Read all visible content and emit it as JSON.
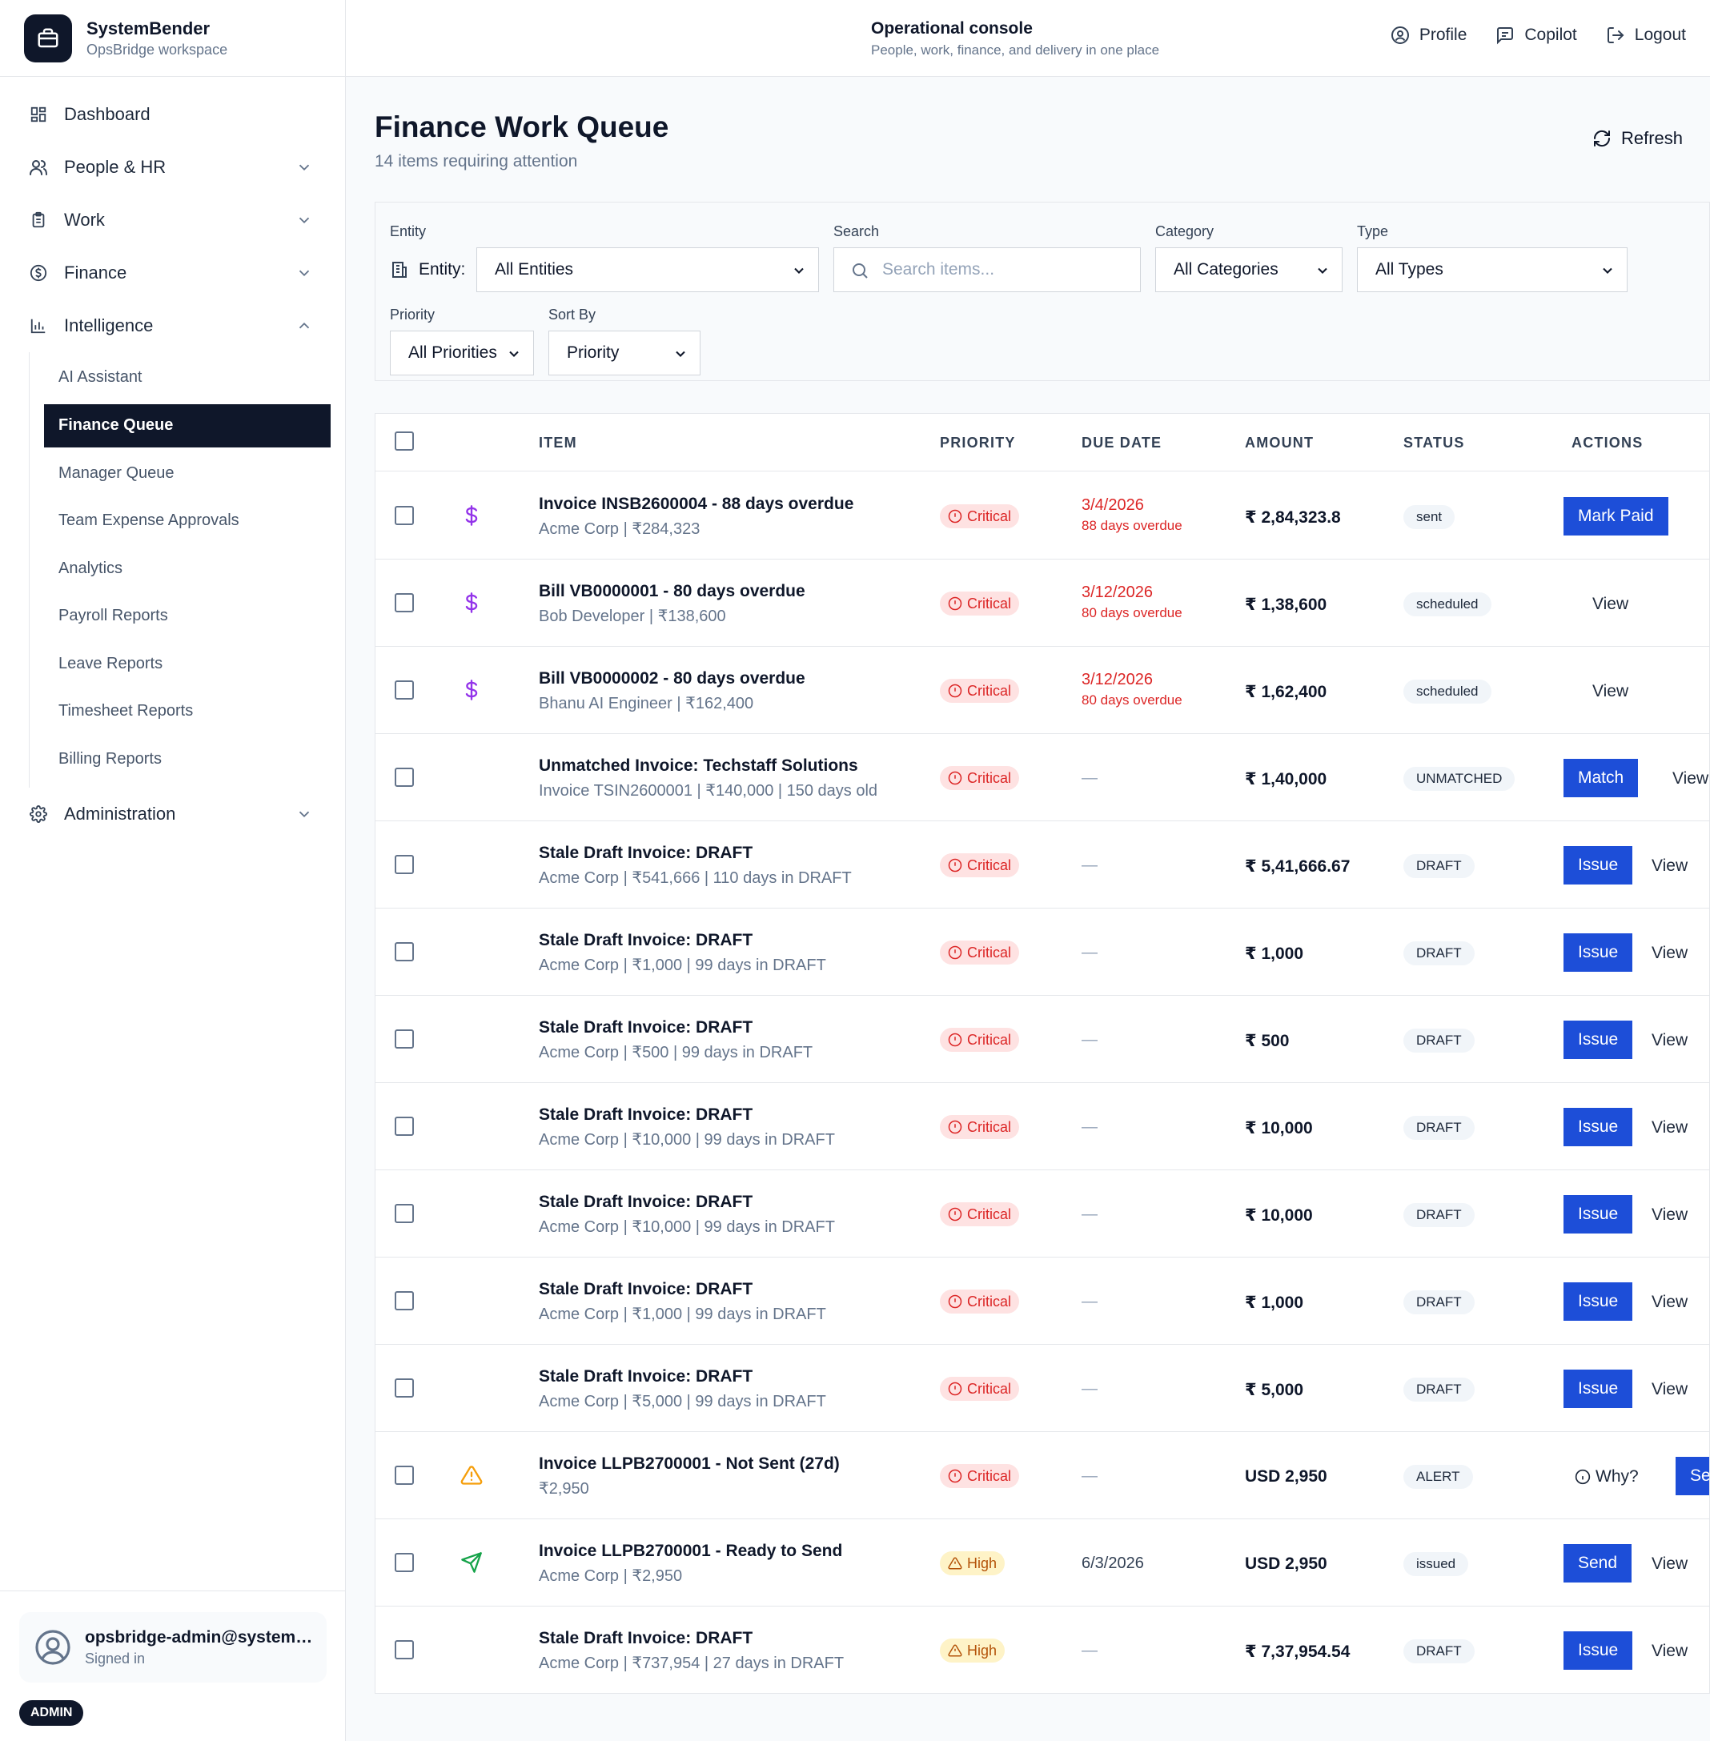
{
  "brand": {
    "name": "SystemBender",
    "workspace": "OpsBridge workspace"
  },
  "header": {
    "title": "Operational console",
    "subtitle": "People, work, finance, and delivery in one place",
    "profile": "Profile",
    "copilot": "Copilot",
    "logout": "Logout"
  },
  "sidebar": {
    "dashboard": "Dashboard",
    "people": "People & HR",
    "work": "Work",
    "finance": "Finance",
    "intelligence": "Intelligence",
    "administration": "Administration",
    "intelligence_items": [
      "AI Assistant",
      "Finance Queue",
      "Manager Queue",
      "Team Expense Approvals",
      "Analytics",
      "Payroll Reports",
      "Leave Reports",
      "Timesheet Reports",
      "Billing Reports"
    ],
    "active_item": "Finance Queue"
  },
  "user": {
    "email": "opsbridge-admin@systembender.com",
    "status": "Signed in",
    "role": "ADMIN"
  },
  "page": {
    "title": "Finance Work Queue",
    "subtitle": "14 items requiring attention",
    "refresh": "Refresh"
  },
  "filters": {
    "entity_label": "Entity",
    "entity_prefix": "Entity:",
    "entity_value": "All Entities",
    "search_label": "Search",
    "search_placeholder": "Search items...",
    "category_label": "Category",
    "category_value": "All Categories",
    "type_label": "Type",
    "type_value": "All Types",
    "priority_label": "Priority",
    "priority_value": "All Priorities",
    "sort_label": "Sort By",
    "sort_value": "Priority"
  },
  "table": {
    "headers": {
      "item": "ITEM",
      "priority": "PRIORITY",
      "due": "DUE DATE",
      "amount": "AMOUNT",
      "status": "STATUS",
      "actions": "ACTIONS"
    },
    "rows": [
      {
        "icon": "dollar-icon",
        "title": "Invoice INSB2600004 - 88 days overdue",
        "sub": "Acme Corp | ₹284,323",
        "priority": "Critical",
        "due": "3/4/2026",
        "due_sub": "88 days overdue",
        "amount": "₹ 2,84,323.8",
        "status": "sent",
        "primary": "Mark Paid",
        "secondary": ""
      },
      {
        "icon": "dollar-icon",
        "title": "Bill VB0000001 - 80 days overdue",
        "sub": "Bob Developer | ₹138,600",
        "priority": "Critical",
        "due": "3/12/2026",
        "due_sub": "80 days overdue",
        "amount": "₹ 1,38,600",
        "status": "scheduled",
        "primary": "",
        "secondary": "View"
      },
      {
        "icon": "dollar-icon",
        "title": "Bill VB0000002 - 80 days overdue",
        "sub": "Bhanu AI Engineer | ₹162,400",
        "priority": "Critical",
        "due": "3/12/2026",
        "due_sub": "80 days overdue",
        "amount": "₹ 1,62,400",
        "status": "scheduled",
        "primary": "",
        "secondary": "View"
      },
      {
        "icon": "",
        "title": "Unmatched Invoice: Techstaff Solutions",
        "sub": "Invoice TSIN2600001 | ₹140,000 | 150 days old",
        "priority": "Critical",
        "due": "—",
        "due_sub": "",
        "amount": "₹ 1,40,000",
        "status": "UNMATCHED",
        "primary": "Match",
        "secondary": "View"
      },
      {
        "icon": "",
        "title": "Stale Draft Invoice: DRAFT",
        "sub": "Acme Corp | ₹541,666 | 110 days in DRAFT",
        "priority": "Critical",
        "due": "—",
        "due_sub": "",
        "amount": "₹ 5,41,666.67",
        "status": "DRAFT",
        "primary": "Issue",
        "secondary": "View"
      },
      {
        "icon": "",
        "title": "Stale Draft Invoice: DRAFT",
        "sub": "Acme Corp | ₹1,000 | 99 days in DRAFT",
        "priority": "Critical",
        "due": "—",
        "due_sub": "",
        "amount": "₹ 1,000",
        "status": "DRAFT",
        "primary": "Issue",
        "secondary": "View"
      },
      {
        "icon": "",
        "title": "Stale Draft Invoice: DRAFT",
        "sub": "Acme Corp | ₹500 | 99 days in DRAFT",
        "priority": "Critical",
        "due": "—",
        "due_sub": "",
        "amount": "₹ 500",
        "status": "DRAFT",
        "primary": "Issue",
        "secondary": "View"
      },
      {
        "icon": "",
        "title": "Stale Draft Invoice: DRAFT",
        "sub": "Acme Corp | ₹10,000 | 99 days in DRAFT",
        "priority": "Critical",
        "due": "—",
        "due_sub": "",
        "amount": "₹ 10,000",
        "status": "DRAFT",
        "primary": "Issue",
        "secondary": "View"
      },
      {
        "icon": "",
        "title": "Stale Draft Invoice: DRAFT",
        "sub": "Acme Corp | ₹10,000 | 99 days in DRAFT",
        "priority": "Critical",
        "due": "—",
        "due_sub": "",
        "amount": "₹ 10,000",
        "status": "DRAFT",
        "primary": "Issue",
        "secondary": "View"
      },
      {
        "icon": "",
        "title": "Stale Draft Invoice: DRAFT",
        "sub": "Acme Corp | ₹1,000 | 99 days in DRAFT",
        "priority": "Critical",
        "due": "—",
        "due_sub": "",
        "amount": "₹ 1,000",
        "status": "DRAFT",
        "primary": "Issue",
        "secondary": "View"
      },
      {
        "icon": "",
        "title": "Stale Draft Invoice: DRAFT",
        "sub": "Acme Corp | ₹5,000 | 99 days in DRAFT",
        "priority": "Critical",
        "due": "—",
        "due_sub": "",
        "amount": "₹ 5,000",
        "status": "DRAFT",
        "primary": "Issue",
        "secondary": "View"
      },
      {
        "icon": "warning-icon",
        "title": "Invoice LLPB2700001 - Not Sent (27d)",
        "sub": "₹2,950",
        "priority": "Critical",
        "due": "—",
        "due_sub": "",
        "amount": "USD 2,950",
        "status": "ALERT",
        "primary": "Send",
        "secondary": "Why?"
      },
      {
        "icon": "send-icon",
        "title": "Invoice LLPB2700001 - Ready to Send",
        "sub": "Acme Corp | ₹2,950",
        "priority": "High",
        "due": "6/3/2026",
        "due_sub": "",
        "amount": "USD 2,950",
        "status": "issued",
        "primary": "Send",
        "secondary": "View"
      },
      {
        "icon": "",
        "title": "Stale Draft Invoice: DRAFT",
        "sub": "Acme Corp | ₹737,954 | 27 days in DRAFT",
        "priority": "High",
        "due": "—",
        "due_sub": "",
        "amount": "₹ 7,37,954.54",
        "status": "DRAFT",
        "primary": "Issue",
        "secondary": "View"
      }
    ]
  },
  "colors": {
    "primary": "#1d4ed8",
    "sidebar_active": "#0f172a",
    "critical": "#dc2626",
    "high": "#b45309",
    "dollar_icon": "#9333ea",
    "warning_icon": "#f59e0b",
    "send_icon": "#16a34a"
  }
}
